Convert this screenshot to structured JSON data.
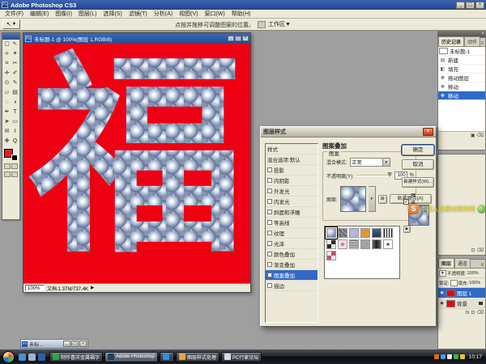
{
  "app": {
    "title": "Adobe Photoshop CS3"
  },
  "icons": {
    "close": "×",
    "minimize": "_",
    "maximize": "▢",
    "menu": "≡",
    "dropdown": "▼",
    "arrow_right": "▶",
    "check": "✓",
    "move_tool": "↖",
    "palette_well": "",
    "new_preset": "⊞",
    "trash": "⌫",
    "new_item": "⊡",
    "camera": "▣"
  },
  "menu_bar": {
    "items": [
      "文件(F)",
      "编辑(E)",
      "图像(I)",
      "图层(L)",
      "选择(S)",
      "滤镜(T)",
      "分析(A)",
      "视图(V)",
      "窗口(W)",
      "帮助(H)"
    ]
  },
  "options_bar": {
    "hint": "点按并拖移可调整图案的位置。",
    "workspace": "工作区▼"
  },
  "tools": {
    "items": [
      {
        "glyph": "▢"
      },
      {
        "glyph": "↖"
      },
      {
        "glyph": "⟡"
      },
      {
        "glyph": "✶"
      },
      {
        "glyph": "⌗"
      },
      {
        "glyph": "✂"
      },
      {
        "glyph": "✛"
      },
      {
        "glyph": "✐"
      },
      {
        "glyph": "⊙"
      },
      {
        "glyph": "✎"
      },
      {
        "glyph": "▱"
      },
      {
        "glyph": "▤"
      },
      {
        "glyph": "◌"
      },
      {
        "glyph": "◑"
      },
      {
        "glyph": "✒"
      },
      {
        "glyph": "T"
      },
      {
        "glyph": "➤"
      },
      {
        "glyph": "▭"
      },
      {
        "glyph": "✉"
      },
      {
        "glyph": "ℓ"
      },
      {
        "glyph": "✥"
      },
      {
        "glyph": "Q"
      }
    ]
  },
  "colors": {
    "canvas_red": "#ee0013",
    "selection_blue": "#316ac5",
    "foreground": "#e02020"
  },
  "document_window": {
    "title": "未标题-1 @ 100%(图层 1,RGB/8)",
    "glyph": "福",
    "status_zoom": "100%",
    "status_doc": "文档:1.37M/737.4K"
  },
  "dialog": {
    "title": "图层样式",
    "styles_label": "样式",
    "blending_label": "混合选项:默认",
    "style_items": [
      {
        "label": "投影"
      },
      {
        "label": "内阴影"
      },
      {
        "label": "外发光"
      },
      {
        "label": "内发光"
      },
      {
        "label": "斜面和浮雕"
      },
      {
        "label": "等高线",
        "indent": true
      },
      {
        "label": "纹理",
        "indent": true
      },
      {
        "label": "光泽"
      },
      {
        "label": "颜色叠加"
      },
      {
        "label": "渐变叠加"
      },
      {
        "label": "图案叠加",
        "selected": true
      },
      {
        "label": "描边"
      }
    ],
    "section_title": "图案叠加",
    "group_label": "图案",
    "blend_mode_label": "混合模式:",
    "blend_mode_value": "正常",
    "opacity_label": "不透明度(Y):",
    "opacity_value": "100",
    "opacity_unit": "%",
    "pattern_label": "图案:",
    "snap_origin_button": "贴紧原点(A)",
    "ok_button": "确定",
    "cancel_button": "取消",
    "new_style_button": "新建样式(W)...",
    "preview_checkbox": "预览(V)",
    "swatches": [
      {
        "bg": "radial-gradient(circle at 35% 30%, #eef2f9 8%, #9fafc9 55%, #52648a 95%)",
        "selected": true
      },
      {
        "bg": "repeating-linear-gradient(45deg,#8d949c 0 2px,#656c74 2px 4px)"
      },
      {
        "bg": "#b6b6d6"
      },
      {
        "bg": "#de9733"
      },
      {
        "bg": "linear-gradient(180deg,#46678c,#22384f)"
      },
      {
        "bg": "repeating-linear-gradient(90deg,#181818 0 1px,#ececec 1px 3px)"
      },
      {
        "bg": "repeating-conic-gradient(#2a2a2a 0% 25%, #f2f2f2 0% 50%)"
      },
      {
        "bg": "radial-gradient(circle at 50% 50%, #d77f92 30%, #f3dfe3 34%)"
      },
      {
        "bg": "repeating-linear-gradient(0deg,#dddddd 0 1px,#6f6f6f 1px 2px)"
      },
      {
        "bg": "repeating-linear-gradient(45deg,#bdbdbd 0 1px,#838383 1px 2px)"
      },
      {
        "bg": "linear-gradient(90deg,#6a6a6a,#1e1e1e 50%,#6a6a6a)"
      },
      {
        "bg": "radial-gradient(circle at 50% 50%, #4d4d4d 22%, #fafafa 26%)"
      },
      {
        "bg": "repeating-conic-gradient(#c05568 0% 25%, #fbe8ec 0% 50%)"
      }
    ]
  },
  "history_panel": {
    "tab_history": "历史记录",
    "tab_actions": "动作",
    "snapshot": "未标题-1",
    "states": [
      {
        "icon": "▤",
        "label": "新建"
      },
      {
        "icon": "◧",
        "label": "填充"
      },
      {
        "icon": "✥",
        "label": "拖动图层"
      },
      {
        "icon": "✥",
        "label": "移动"
      },
      {
        "icon": "✥",
        "label": "移动",
        "selected": true
      }
    ]
  },
  "layers_panel": {
    "tab_layers": "图层",
    "tab_channels": "通道",
    "opacity_label": "不透明度:",
    "opacity_value": "100%",
    "lock_label": "锁定:",
    "fill_label": "填充:",
    "fill_value": "100%",
    "layers": [
      {
        "name": "图层 1",
        "selected": true
      },
      {
        "name": "背景",
        "locked": true
      }
    ]
  },
  "watermark": {
    "logo": "S",
    "text": "中国人像素材图库网"
  },
  "minimized_window": {
    "title": "未标..."
  },
  "taskbar": {
    "quick_launch": [
      "#4a8fd0",
      "#9fb4c8",
      "#2f5fa8"
    ],
    "tasks": [
      {
        "label": "制作喜庆金属福字贴...",
        "color": "#2fa848"
      },
      {
        "label": "Adobe Photoshop C...",
        "color": "#1f3f66",
        "active": true
      },
      {
        "label": "",
        "color": "#2f8fe0"
      },
      {
        "label": "图层样式处理",
        "color": "#e8a33d"
      },
      {
        "label": "PC行家论坛",
        "color": "#dcdcdc"
      }
    ],
    "tray_colors": [
      "#e06820",
      "#3fa0e0",
      "#e8e8e8",
      "#48b048",
      "#e8c820"
    ],
    "clock": "10:17"
  }
}
